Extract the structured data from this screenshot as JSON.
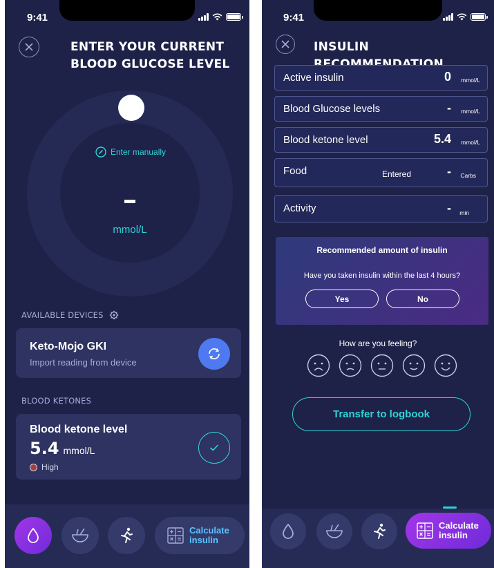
{
  "screen1": {
    "status_time": "9:41",
    "title_line1": "ENTER YOUR CURRENT",
    "title_line2": "BLOOD GLUCOSE LEVEL",
    "enter_manually": "Enter manually",
    "dial_unit": "mmol/L",
    "devices_label": "AVAILABLE DEVICES",
    "device": {
      "name": "Keto-Mojo GKI",
      "subtitle": "Import reading from device"
    },
    "ketones_label": "BLOOD KETONES",
    "ketone_card": {
      "title": "Blood ketone level",
      "value": "5.4",
      "unit": "mmol/L",
      "status": "High"
    },
    "calc_line1": "Calculate",
    "calc_line2": "insulin"
  },
  "screen2": {
    "status_time": "9:41",
    "title": "INSULIN RECOMMENDATION",
    "fields": [
      {
        "label": "Active insulin",
        "value": "0",
        "unit": "mmol/L"
      },
      {
        "label": "Blood Glucose levels",
        "value": "-",
        "unit": "mmol/L"
      },
      {
        "label": "Blood ketone level",
        "value": "5.4",
        "unit": "mmol/L"
      },
      {
        "label": "Food",
        "entered": "Entered",
        "value": "-",
        "unit": "Carbs"
      },
      {
        "label": "Activity",
        "value": "-",
        "unit": "min"
      }
    ],
    "recommend_title": "Recommended amount of insulin",
    "recommend_question": "Have you taken insulin within the last 4 hours?",
    "yes": "Yes",
    "no": "No",
    "feeling": "How are you feeling?",
    "transfer": "Transfer to logbook",
    "calc_line1": "Calculate",
    "calc_line2": "insulin"
  },
  "colors": {
    "background": "#1e2248",
    "accent_cyan": "#2fd3d6",
    "accent_purple": "#a236e8",
    "sync_blue": "#4f79f0",
    "status_high": "#a0413f"
  }
}
